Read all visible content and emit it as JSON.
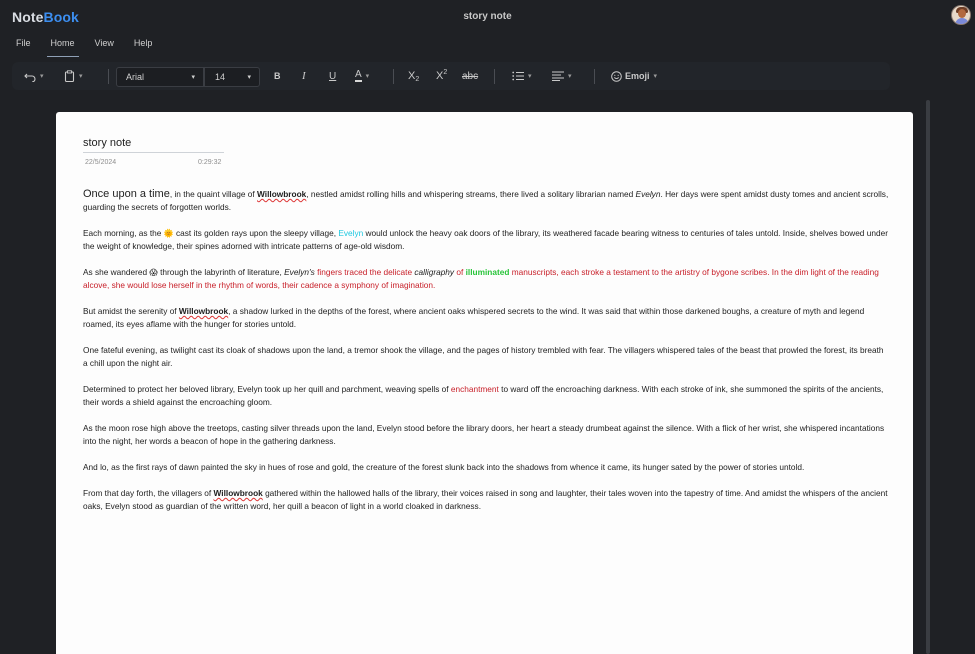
{
  "app": {
    "logo_part1": "Note",
    "logo_part2": "Book",
    "doc_title": "story note"
  },
  "menu": [
    {
      "label": "File"
    },
    {
      "label": "Home",
      "active": true
    },
    {
      "label": "View"
    },
    {
      "label": "Help"
    }
  ],
  "toolbar": {
    "font": "Arial",
    "size": "14",
    "bold": "B",
    "italic": "I",
    "underline": "U",
    "font_color": "A",
    "subscript": "X",
    "subscript_mark": "2",
    "superscript": "X",
    "superscript_mark": "2",
    "strike": "abc",
    "emoji": "Emoji",
    "icons": [
      "undo-icon",
      "clipboard-icon",
      "bullet-list-icon",
      "align-icon",
      "emoji-icon"
    ]
  },
  "note": {
    "title": "story note",
    "date": "22/5/2024",
    "time": "0:29:32"
  },
  "story": {
    "p1_a": "Once upon a time",
    "p1_b": ", in the quaint village of ",
    "w": "Willowbrook",
    "p1_c": ", nestled amidst rolling hills and whispering streams, there lived a solitary librarian named ",
    "evelyn": "Evelyn",
    "p1_d": ". Her days were spent amidst dusty tomes and ancient scrolls, guarding the secrets of forgotten worlds.",
    "p2_a": "Each morning, as the ",
    "sun": "🌞",
    "p2_b": " cast its golden rays upon the sleepy village, ",
    "p2_c": " would unlock the heavy oak doors of the library, its weathered facade bearing witness to centuries of tales untold. Inside, shelves bowed under the weight of knowledge, their spines adorned with intricate patterns of age-old wisdom.",
    "p3_a": "As she wandered ",
    "scream": "😱",
    "p3_b": " through the labyrinth of literature, ",
    "evelyns": "Evelyn's",
    "p3_c": " fingers traced the delicate ",
    "calligraphy": "calligraphy",
    "p3_d": " of ",
    "illuminated": "illuminated",
    "p3_e": " manuscripts, each stroke a testament to the artistry of bygone scribes. In the dim light of the reading alcove, she would lose herself in the rhythm of words, their cadence a symphony of imagination.",
    "p4_a": "But amidst the serenity of ",
    "p4_b": ", a shadow lurked in the depths of the forest, where ancient oaks whispered secrets to the wind. It was said that within those darkened boughs, a creature of myth and legend roamed, its eyes aflame with the hunger for stories untold.",
    "p5": "One fateful evening, as twilight cast its cloak of shadows upon the land, a tremor shook the village, and the pages of history trembled with fear. The villagers whispered tales of the beast that prowled the forest, its breath a chill upon the night air.",
    "p6_a": "Determined to protect her beloved library, Evelyn took up her quill and parchment, weaving spells of ",
    "enchantment": "enchantment",
    "p6_b": " to ward off the encroaching darkness. With each stroke of ink, she summoned the spirits of the ancients, their words a shield against the encroaching gloom.",
    "p7": "As the moon rose high above the treetops, casting silver threads upon the land, Evelyn stood before the library doors, her heart a steady drumbeat against the silence. With a flick of her wrist, she whispered incantations into the night, her words a beacon of hope in the gathering darkness.",
    "p8": "And lo, as the first rays of dawn painted the sky in hues of rose and gold, the creature of the forest slunk back into the shadows from whence it came, its hunger sated by the power of stories untold.",
    "p9_a": "From that day forth, the villagers of ",
    "p9_b": " gathered within the hallowed halls of the library, their voices raised in song and laughter, their tales woven into the tapestry of time. And amidst the whispers of the ancient oaks, Evelyn stood as guardian of the written word, her quill a beacon of light in a world cloaked in darkness."
  },
  "colors": {
    "accent": "#3c8ef0",
    "red_text": "#c8202a",
    "cyan_text": "#1ec8e0",
    "green_text": "#29c43a",
    "bg": "#1f2125"
  }
}
